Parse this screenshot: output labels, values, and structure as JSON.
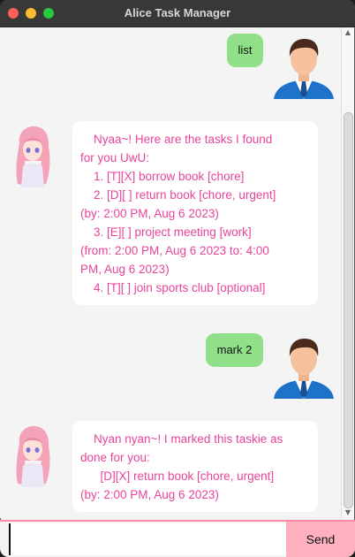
{
  "window": {
    "title": "Alice Task Manager"
  },
  "messages": {
    "m1": {
      "sender": "user",
      "text": "list"
    },
    "m2": {
      "sender": "bot",
      "lines": [
        "    Nyaa~! Here are the tasks I found",
        "for you UwU:",
        "    1. [T][X] borrow book [chore]",
        "    2. [D][ ] return book [chore, urgent]",
        "(by: 2:00 PM, Aug 6 2023)",
        "    3. [E][ ] project meeting [work]",
        "(from: 2:00 PM, Aug 6 2023 to: 4:00",
        "PM, Aug 6 2023)",
        "    4. [T][ ] join sports club [optional]"
      ]
    },
    "m3": {
      "sender": "user",
      "text": "mark 2"
    },
    "m4": {
      "sender": "bot",
      "lines": [
        "    Nyan nyan~! I marked this taskie as",
        "done for you:",
        "      [D][X] return book [chore, urgent]",
        "(by: 2:00 PM, Aug 6 2023)"
      ]
    }
  },
  "input": {
    "value": "",
    "placeholder": ""
  },
  "send_button": {
    "label": "Send"
  },
  "icons": {
    "user_avatar": "businessman-avatar-icon",
    "bot_avatar": "anime-girl-avatar-icon"
  },
  "colors": {
    "user_bubble": "#8fe088",
    "bot_text": "#e8449a",
    "send_button": "#ffb1c1",
    "input_border": "#ff8aa5"
  }
}
